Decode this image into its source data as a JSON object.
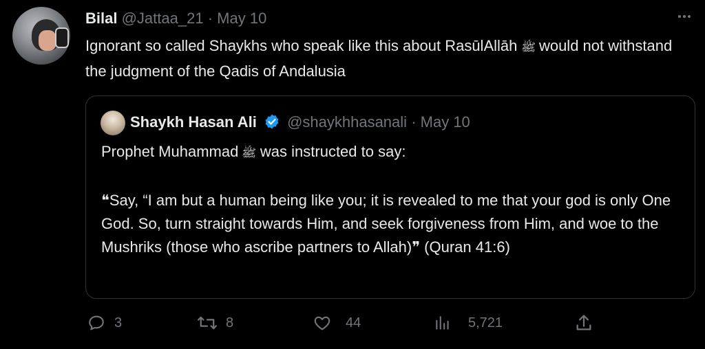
{
  "tweet": {
    "display_name": "Bilal",
    "handle": "@Jattaa_21",
    "separator": "·",
    "date": "May 10",
    "more_icon": "more-horizontal-icon",
    "text_part1": "Ignorant so called Shaykhs who speak like this about RasūlAllāh",
    "honorific": "ﷺ",
    "text_part2": "would not withstand the judgment of the Qadis of Andalusia"
  },
  "quote": {
    "display_name": "Shaykh Hasan Ali",
    "verified_icon": "verified-badge-icon",
    "handle": "@shaykhhasanali",
    "separator": "·",
    "date": "May 10",
    "line1_part1": "Prophet Muhammad",
    "honorific": "ﷺ",
    "line1_part2": "was instructed to say:",
    "quote_open": "❝",
    "quote_body": "Say, “I am but a human being like you; it is revealed to me that your god is only One God. So, turn straight towards Him, and seek forgiveness from Him, and woe to the Mushriks (those who ascribe partners to Allah)",
    "quote_close": "❞",
    "citation": "(Quran 41:6)"
  },
  "actions": {
    "reply_count": "3",
    "retweet_count": "8",
    "like_count": "44",
    "views_count": "5,721"
  },
  "colors": {
    "background": "#000000",
    "text": "#e7e9ea",
    "muted": "#71767b",
    "border": "#2f3336",
    "verified": "#1d9bf0"
  }
}
